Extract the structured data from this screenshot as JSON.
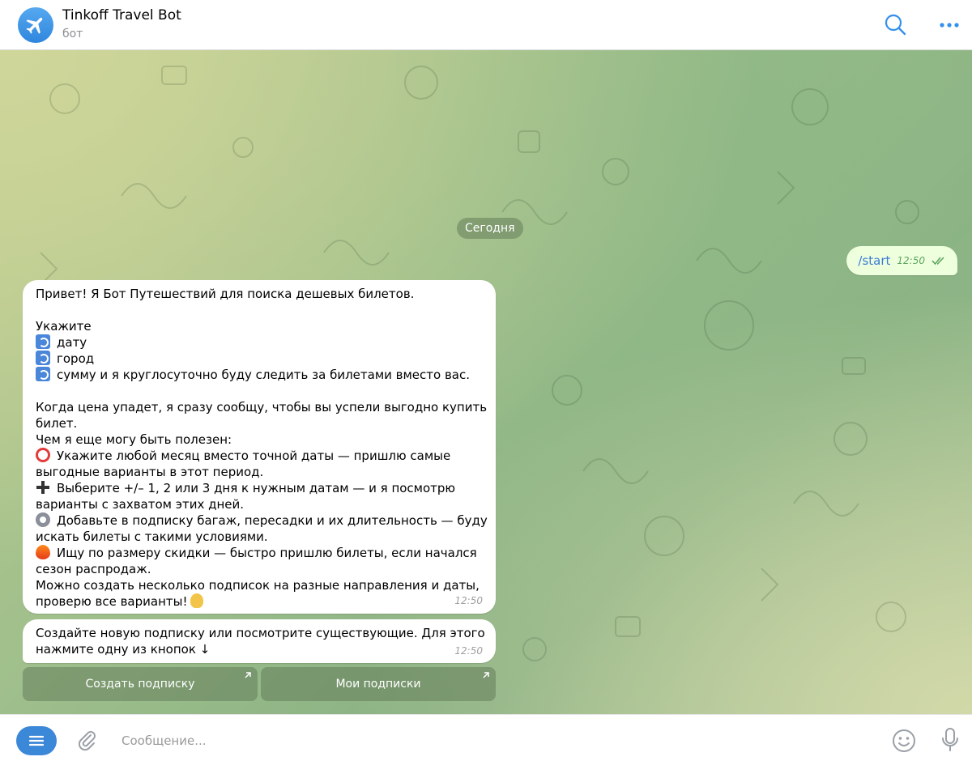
{
  "header": {
    "title": "Tinkoff Travel Bot",
    "subtitle": "бот",
    "avatar_icon": "airplane-icon",
    "accent": "#3390ec"
  },
  "chat": {
    "date_label": "Сегодня",
    "outgoing": {
      "text": "/start",
      "time": "12:50",
      "status": "double-check-icon"
    },
    "message1": {
      "lines": [
        {
          "emoji": "",
          "text": "Привет! Я Бот Путешествий для поиска дешевых билетов."
        },
        {
          "emoji": "",
          "text": ""
        },
        {
          "emoji": "",
          "text": "Укажите"
        },
        {
          "emoji": "arrows-icon",
          "text": "дату"
        },
        {
          "emoji": "arrows-icon",
          "text": "город"
        },
        {
          "emoji": "arrows-icon",
          "text": "сумму и я круглосуточно буду следить за билетами вместо вас."
        },
        {
          "emoji": "",
          "text": ""
        },
        {
          "emoji": "",
          "text": "Когда цена упадет, я сразу сообщу, чтобы вы успели выгодно купить"
        },
        {
          "emoji": "",
          "text": "билет."
        },
        {
          "emoji": "",
          "text": "Чем я еще могу быть полезен:"
        },
        {
          "emoji": "alarm-clock-icon",
          "text": "Укажите любой месяц вместо точной даты — пришлю самые"
        },
        {
          "emoji": "",
          "text": "выгодные варианты в этот период."
        },
        {
          "emoji": "plus-icon",
          "text": "Выберите +/– 1, 2 или 3 дня к нужным датам — и я посмотрю"
        },
        {
          "emoji": "",
          "text": "варианты с захватом этих дней."
        },
        {
          "emoji": "gear-icon",
          "text": "Добавьте в подписку багаж, пересадки и их длительность — буду"
        },
        {
          "emoji": "",
          "text": "искать билеты с такими условиями."
        },
        {
          "emoji": "fire-icon",
          "text": "Ищу по размеру скидки — быстро пришлю билеты, если начался"
        },
        {
          "emoji": "",
          "text": "сезон распродаж."
        },
        {
          "emoji": "",
          "text": "Можно создать несколько подписок на разные направления и даты,"
        },
        {
          "emoji": "",
          "text": "проверю все варианты!"
        }
      ],
      "trailing_emoji": "ok-hand-icon",
      "time": "12:50"
    },
    "message2": {
      "lines": [
        "Создайте новую подписку или посмотрите существующие. Для этого",
        "нажмите одну из кнопок ↓"
      ],
      "time": "12:50"
    },
    "keyboard": [
      {
        "label": "Создать подписку"
      },
      {
        "label": "Мои подписки"
      }
    ]
  },
  "composer": {
    "placeholder": "Сообщение...",
    "value": ""
  }
}
